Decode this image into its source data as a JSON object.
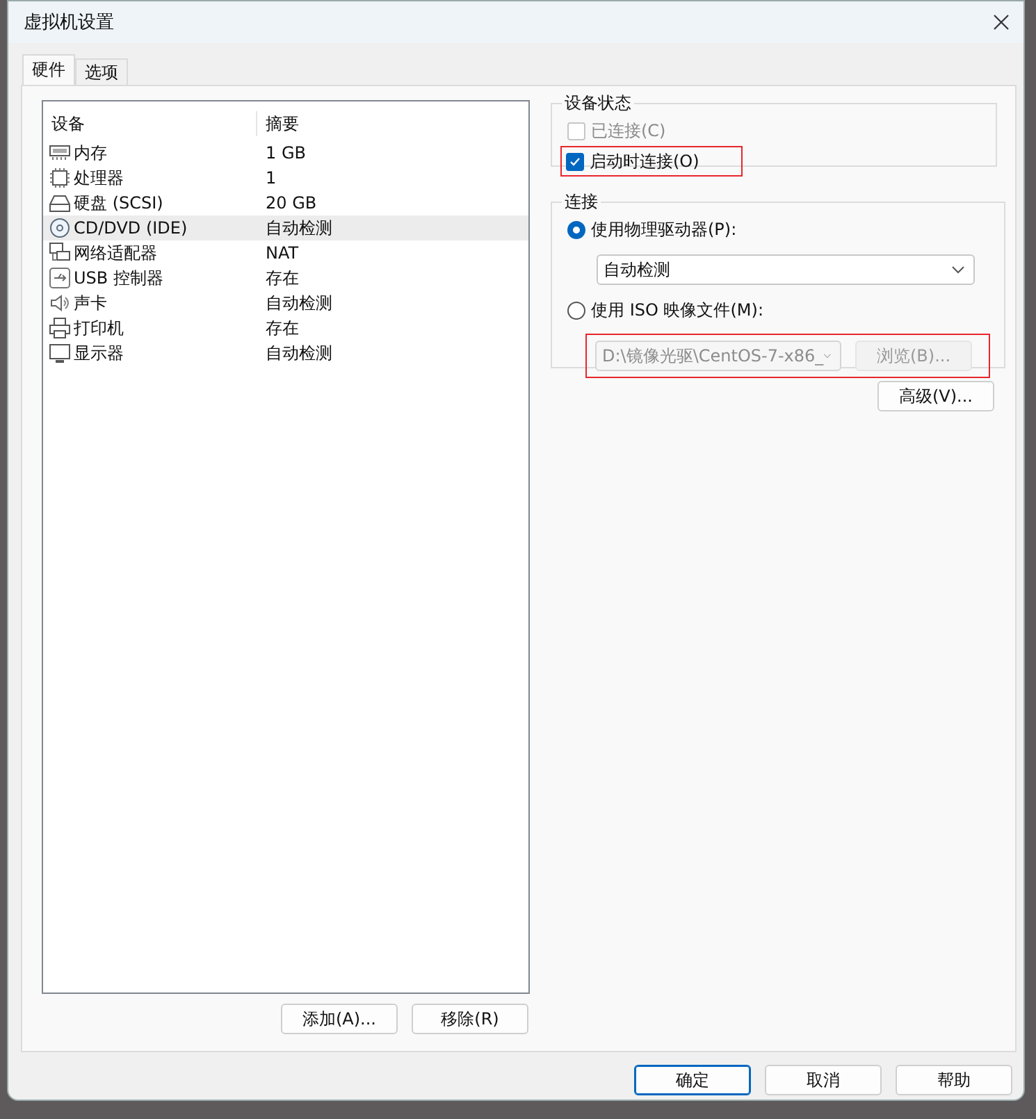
{
  "window": {
    "title": "虚拟机设置"
  },
  "tabs": [
    {
      "label": "硬件",
      "selected": true
    },
    {
      "label": "选项",
      "selected": false
    }
  ],
  "device_table": {
    "columns": [
      "设备",
      "摘要"
    ],
    "rows": [
      {
        "device": "内存",
        "summary": "1 GB",
        "selected": false
      },
      {
        "device": "处理器",
        "summary": "1",
        "selected": false
      },
      {
        "device": "硬盘 (SCSI)",
        "summary": "20 GB",
        "selected": false
      },
      {
        "device": "CD/DVD (IDE)",
        "summary": "自动检测",
        "selected": true
      },
      {
        "device": "网络适配器",
        "summary": "NAT",
        "selected": false
      },
      {
        "device": "USB 控制器",
        "summary": "存在",
        "selected": false
      },
      {
        "device": "声卡",
        "summary": "自动检测",
        "selected": false
      },
      {
        "device": "打印机",
        "summary": "存在",
        "selected": false
      },
      {
        "device": "显示器",
        "summary": "自动检测",
        "selected": false
      }
    ]
  },
  "device_buttons": [
    "添加(A)...",
    "移除(R)"
  ],
  "device_status": {
    "title": "设备状态",
    "options": [
      {
        "label": "已连接(C)",
        "checked": false,
        "disabled": true,
        "highlighted": false
      },
      {
        "label": "启动时连接(O)",
        "checked": true,
        "disabled": false,
        "highlighted": true
      }
    ]
  },
  "connection": {
    "title": "连接",
    "options": [
      {
        "label": "使用物理驱动器(P):",
        "selected": true,
        "field": {
          "value": "自动检测",
          "disabled": false
        },
        "highlighted": false
      },
      {
        "label": "使用 ISO 映像文件(M):",
        "selected": false,
        "field": {
          "value": "D:\\镜像光驱\\CentOS-7-x86_",
          "disabled": true
        },
        "browse_button": "浏览(B)...",
        "highlighted": true
      }
    ]
  },
  "advanced_button": "高级(V)...",
  "dialog_buttons": [
    {
      "label": "确定",
      "default": true
    },
    {
      "label": "取消",
      "default": false
    },
    {
      "label": "帮助",
      "default": false
    }
  ]
}
